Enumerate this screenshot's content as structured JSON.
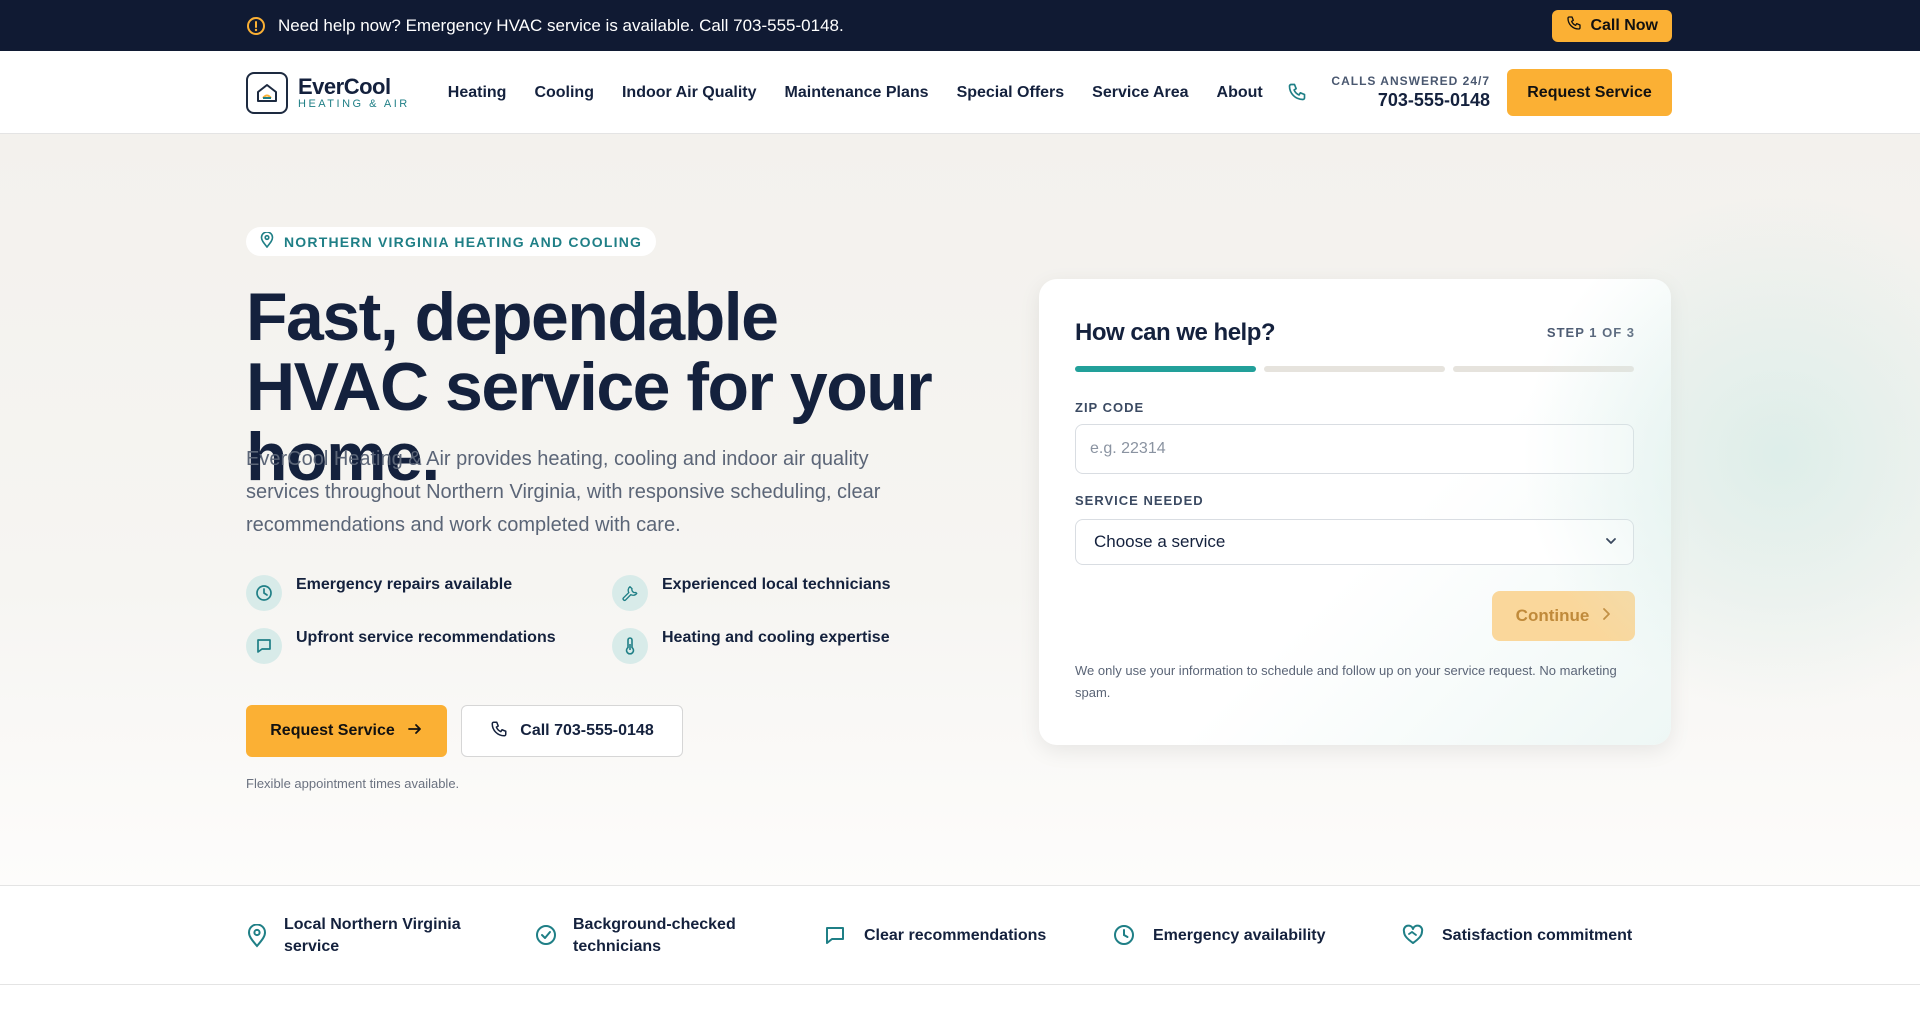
{
  "topbar": {
    "message": "Need help now? Emergency HVAC service is available. Call 703-555-0148.",
    "call_now": "Call Now",
    "icon": "alert-circle-icon"
  },
  "header": {
    "logo_name": "EverCool",
    "logo_tagline": "HEATING & AIR",
    "nav": [
      "Heating",
      "Cooling",
      "Indoor Air Quality",
      "Maintenance Plans",
      "Special Offers",
      "Service Area",
      "About"
    ],
    "calls_caption": "CALLS ANSWERED 24/7",
    "phone": "703-555-0148",
    "request_button": "Request Service"
  },
  "hero": {
    "badge": "NORTHERN VIRGINIA HEATING AND COOLING",
    "title": "Fast, dependable HVAC service for your home.",
    "description": "EverCool Heating & Air provides heating, cooling and indoor air quality services throughout Northern Virginia, with responsive scheduling, clear recommendations and work completed with care.",
    "features": [
      {
        "label": "Emergency repairs available",
        "icon": "clock-icon"
      },
      {
        "label": "Experienced local technicians",
        "icon": "wrench-icon"
      },
      {
        "label": "Upfront service recommendations",
        "icon": "message-icon"
      },
      {
        "label": "Heating and cooling expertise",
        "icon": "thermometer-icon"
      }
    ],
    "cta_primary": "Request Service",
    "cta_secondary": "Call 703-555-0148",
    "note": "Flexible appointment times available."
  },
  "form": {
    "title": "How can we help?",
    "step": "STEP 1 OF 3",
    "progress_step": 1,
    "progress_total": 3,
    "zip_label": "ZIP CODE",
    "zip_placeholder": "e.g. 22314",
    "zip_value": "",
    "service_label": "SERVICE NEEDED",
    "service_selected": "Choose a service",
    "continue": "Continue",
    "privacy": "We only use your information to schedule and follow up on your service request. No marketing spam."
  },
  "trust": [
    {
      "label": "Local Northern Virginia service",
      "icon": "map-pin-icon"
    },
    {
      "label": "Background-checked technicians",
      "icon": "badge-check-icon"
    },
    {
      "label": "Clear recommendations",
      "icon": "message-icon"
    },
    {
      "label": "Emergency availability",
      "icon": "clock-icon"
    },
    {
      "label": "Satisfaction commitment",
      "icon": "heart-handshake-icon"
    }
  ],
  "colors": {
    "accent": "#fbb034",
    "navy": "#101a33",
    "teal": "#1f7f86",
    "progress": "#22a09a"
  }
}
